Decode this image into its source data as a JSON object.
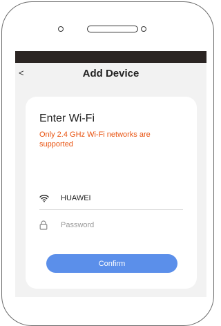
{
  "header": {
    "back_icon": "chevron-left-icon",
    "back_glyph": "<",
    "title": "Add Device"
  },
  "card": {
    "heading": "Enter Wi-Fi",
    "note": "Only 2.4 GHz Wi-Fi networks are supported",
    "note_color": "#e8520f"
  },
  "wifi_field": {
    "icon": "wifi-icon",
    "value": "HUAWEI"
  },
  "password_field": {
    "icon": "lock-icon",
    "placeholder": "Password"
  },
  "confirm_button": {
    "label": "Confirm",
    "color": "#5b8fea"
  }
}
